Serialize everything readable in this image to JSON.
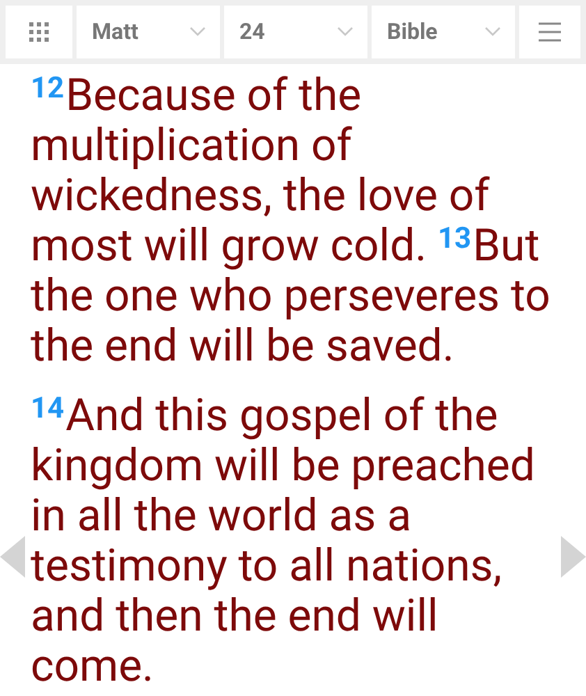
{
  "toolbar": {
    "book": "Matt",
    "chapter": "24",
    "version": "Bible"
  },
  "paragraphs": [
    {
      "verses": [
        {
          "number": "12",
          "text": "Because of the multiplication of wickedness, the love of most will grow cold. "
        },
        {
          "number": "13",
          "text": "But the one who perseveres to the end will be saved."
        }
      ]
    },
    {
      "verses": [
        {
          "number": "14",
          "text": "And this gospel of the kingdom will be preached in all the world as a testimony to all nations, and then the end will come."
        }
      ]
    }
  ]
}
